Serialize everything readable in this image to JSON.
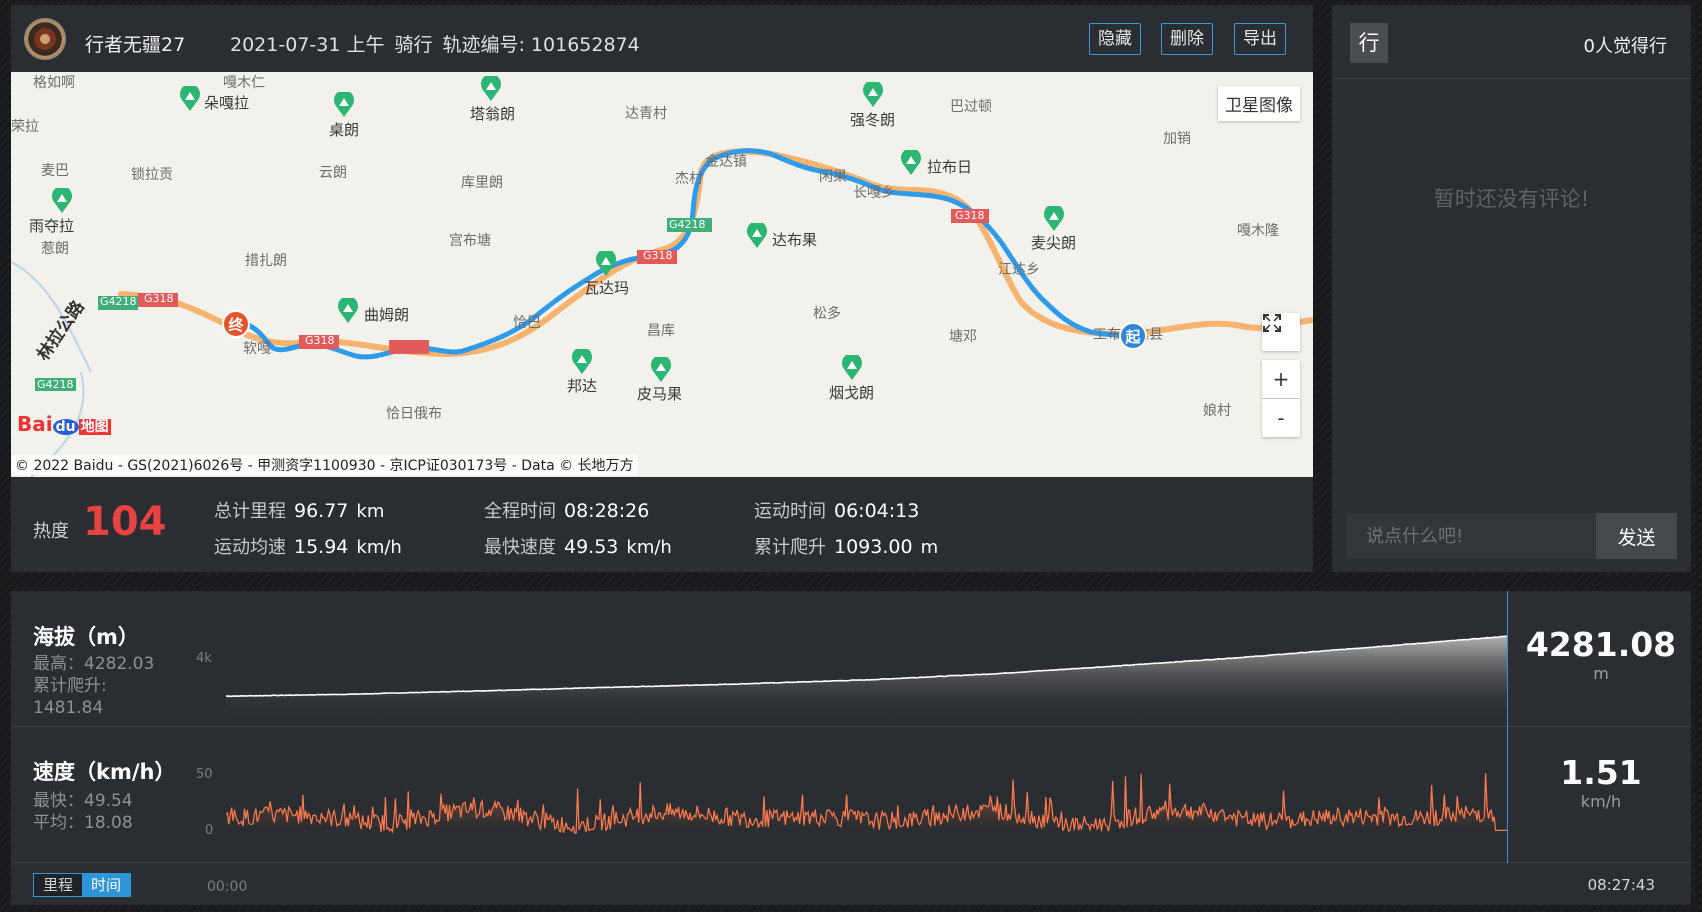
{
  "header": {
    "user_name": "行者无疆27",
    "date": "2021-07-31 上午",
    "activity": "骑行",
    "track_id_label": "轨迹编号: 101652874",
    "buttons": {
      "hide": "隐藏",
      "delete": "删除",
      "export": "导出"
    }
  },
  "map": {
    "satellite_label": "卫星图像",
    "zoom_in": "+",
    "zoom_out": "-",
    "copyright": "© 2022 Baidu - GS(2021)6026号 - 甲测资字1100930 - 京ICP证030173号 - Data © 长地万方",
    "start_marker": "起",
    "end_marker": "终",
    "road_label": "林拉公路",
    "logo_text": "Bai",
    "logo_du": "du",
    "logo_map": "地图",
    "pois": [
      "朵嘎拉",
      "桌朗",
      "塔翁朗",
      "强冬朗",
      "拉布日",
      "雨夺拉",
      "达布果",
      "麦尖朗",
      "瓦达玛",
      "曲姆朗",
      "邦达",
      "皮马果",
      "烟戈朗"
    ],
    "labels": [
      "格如啊",
      "嘎木仁",
      "荣拉",
      "达青村",
      "巴过顿",
      "加销",
      "麦巴",
      "锁拉贡",
      "云朗",
      "库里朗",
      "杰村",
      "金达镇",
      "闲果",
      "长嘎乡",
      "嘎木隆",
      "惹朗",
      "宫布塘",
      "措扎朗",
      "江达乡",
      "工布江达县",
      "恰巴",
      "昌库",
      "松多",
      "塘邓",
      "软嘎",
      "恰日俄布",
      "娘村"
    ],
    "shields": [
      "G4218",
      "G318",
      "G4218",
      "G318",
      "G318",
      "G318",
      "G4218"
    ]
  },
  "stats": {
    "heat_label": "热度",
    "heat_value": "104",
    "total_distance": {
      "label": "总计里程",
      "value": "96.77",
      "unit": "km"
    },
    "total_time": {
      "label": "全程时间",
      "value": "08:28:26"
    },
    "moving_time": {
      "label": "运动时间",
      "value": "06:04:13"
    },
    "avg_speed": {
      "label": "运动均速",
      "value": "15.94",
      "unit": "km/h"
    },
    "max_speed": {
      "label": "最快速度",
      "value": "49.53",
      "unit": "km/h"
    },
    "total_climb": {
      "label": "累计爬升",
      "value": "1093.00",
      "unit": "m"
    }
  },
  "comments": {
    "badge": "行",
    "like_count": "0人觉得行",
    "empty_text": "暂时还没有评论!",
    "input_placeholder": "说点什么吧!",
    "send_label": "发送"
  },
  "charts": {
    "altitude": {
      "title": "海拔（m）",
      "max_line": "最高：4282.03",
      "climb_line": "累计爬升:",
      "climb_value": "1481.84",
      "y_tick": "4k",
      "readout_value": "4281.08",
      "readout_unit": "m"
    },
    "speed": {
      "title": "速度（km/h）",
      "max_line": "最快：49.54",
      "avg_line": "平均：18.08",
      "y_tick_top": "50",
      "y_tick_bottom": "0",
      "readout_value": "1.51",
      "readout_unit": "km/h"
    },
    "toggle": {
      "distance": "里程",
      "time": "时间"
    },
    "x_start": "00:00",
    "x_end": "08:27:43"
  },
  "chart_data": [
    {
      "type": "area",
      "title": "海拔（m）",
      "x": [
        0,
        0.1,
        0.2,
        0.3,
        0.4,
        0.5,
        0.6,
        0.7,
        0.8,
        0.9,
        1.0
      ],
      "values": [
        3400,
        3430,
        3480,
        3530,
        3580,
        3640,
        3730,
        3850,
        3980,
        4130,
        4281
      ],
      "ylim": [
        3300,
        4300
      ],
      "colors": {
        "line": "#ffffff"
      }
    },
    {
      "type": "area",
      "title": "速度（km/h）",
      "ylim": [
        0,
        55
      ],
      "colors": {
        "line": "#ff7a4d"
      }
    }
  ]
}
